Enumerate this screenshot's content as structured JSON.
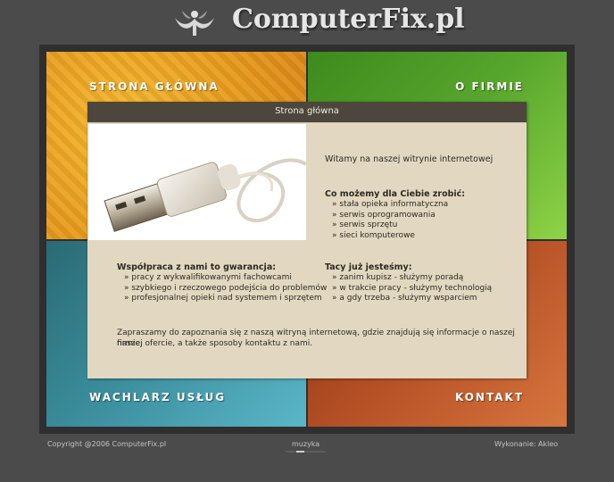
{
  "header": {
    "site_title": "ComputerFix.pl",
    "logo_icon": "figure-logo-icon"
  },
  "nav": {
    "home": "STRONA GŁÓWNA",
    "about": "O FIRMIE",
    "services": "WACHLARZ USŁUG",
    "contact": "KONTAKT"
  },
  "content": {
    "title": "Strona główna",
    "welcome": "Witamy na naszej witrynie internetowej",
    "offer_heading": "Co możemy dla Ciebie zrobić:",
    "offer_items": [
      "stała opieka informatyczna",
      "serwis oprogramowania",
      "serwis sprzętu",
      "sieci komputerowe"
    ],
    "guarantee_heading": "Współpraca z nami to gwarancja:",
    "guarantee_items": [
      "pracy z wykwalifikowanymi fachowcami",
      "szybkiego i rzeczowego podejścia do problemów",
      "profesjonalnej opieki nad systemem i sprzętem"
    ],
    "about_heading": "Tacy już jesteśmy:",
    "about_items": [
      "zanim kupisz - służymy poradą",
      "w trakcie pracy - służymy technologią",
      "a gdy trzeba - służymy wsparciem"
    ],
    "intro_line1": "Zapraszamy do zapoznania się z naszą witryną internetową, gdzie znajdują się informacje o naszej firmie,",
    "intro_line2": "naszej ofercie, a także sposoby kontaktu z nami."
  },
  "footer": {
    "copyright": "Copyright @2006 ComputerFix.pl",
    "music": "muzyka",
    "credit_label": "Wykonanie:",
    "credit_author": "Akleo"
  },
  "colors": {
    "background": "#4b4b4b",
    "quad_orange": "#e89b1c",
    "quad_green": "#57a62c",
    "quad_teal": "#3a8c9a",
    "quad_rust": "#b34e24",
    "content_bg": "#e2d8c1",
    "titlebar": "#4c463d"
  }
}
